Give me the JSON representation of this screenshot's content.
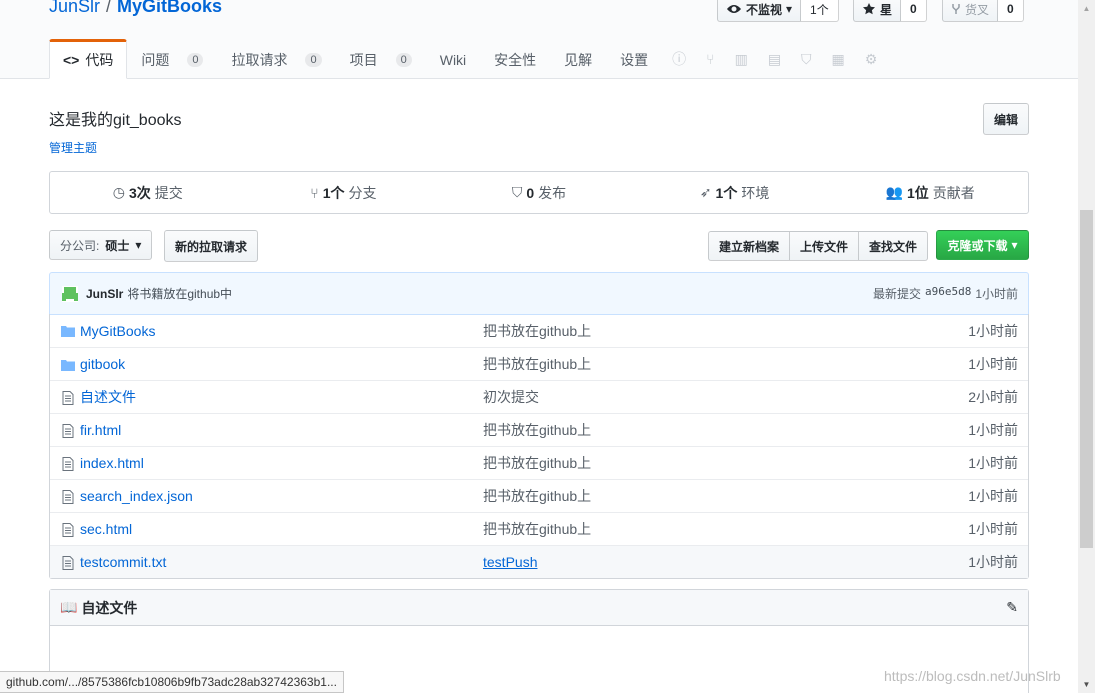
{
  "repo": {
    "owner": "JunSlr",
    "separator": "/",
    "name": "MyGitBooks"
  },
  "actions": {
    "watch_label": "不监视",
    "watch_count": "1个",
    "star_label": "星",
    "star_count": "0",
    "fork_label": "货叉",
    "fork_count": "0"
  },
  "nav": {
    "tabs": [
      {
        "label": "代码",
        "icon": "code-icon"
      },
      {
        "label": "问题",
        "count": "0"
      },
      {
        "label": "拉取请求",
        "count": "0"
      },
      {
        "label": "项目",
        "count": "0"
      },
      {
        "label": "Wiki"
      },
      {
        "label": "安全性"
      },
      {
        "label": "见解"
      },
      {
        "label": "设置"
      }
    ],
    "extra_icons": [
      "issue-opened-icon",
      "pull-request-icon",
      "project-icon",
      "book-icon",
      "shield-icon",
      "graph-icon",
      "gear-icon"
    ]
  },
  "about": {
    "description": "这是我的git_books",
    "topics_link": "管理主题",
    "edit_label": "编辑"
  },
  "summary": {
    "commits": {
      "num": "3次",
      "label": "提交",
      "icon": "history-icon"
    },
    "branches": {
      "num": "1个",
      "label": "分支",
      "icon": "branch-icon"
    },
    "releases": {
      "num": "0",
      "label": "发布",
      "icon": "tag-icon"
    },
    "environments": {
      "num": "1个",
      "label": "环境",
      "icon": "rocket-icon"
    },
    "contributors": {
      "num": "1位",
      "label": "贡献者",
      "icon": "people-icon"
    }
  },
  "file_nav": {
    "branch_label": "分公司:",
    "branch_value": "硕士",
    "new_pr": "新的拉取请求",
    "create_file": "建立新档案",
    "upload_files": "上传文件",
    "find_file": "查找文件",
    "clone": "克隆或下载"
  },
  "commit_tease": {
    "author": "JunSlr",
    "message": "将书籍放在github中",
    "latest_label": "最新提交",
    "sha": "a96e5d8",
    "age": "1小时前"
  },
  "files": [
    {
      "type": "folder",
      "name": "MyGitBooks",
      "message": "把书放在github上",
      "age": "1小时前"
    },
    {
      "type": "folder",
      "name": "gitbook",
      "message": "把书放在github上",
      "age": "1小时前"
    },
    {
      "type": "file",
      "name": "自述文件",
      "message": "初次提交",
      "age": "2小时前"
    },
    {
      "type": "file",
      "name": "fir.html",
      "message": "把书放在github上",
      "age": "1小时前"
    },
    {
      "type": "file",
      "name": "index.html",
      "message": "把书放在github上",
      "age": "1小时前"
    },
    {
      "type": "file",
      "name": "search_index.json",
      "message": "把书放在github上",
      "age": "1小时前"
    },
    {
      "type": "file",
      "name": "sec.html",
      "message": "把书放在github上",
      "age": "1小时前"
    },
    {
      "type": "file",
      "name": "testcommit.txt",
      "message": "testPush",
      "age": "1小时前"
    }
  ],
  "readme": {
    "title": "自述文件"
  },
  "status_url": "github.com/.../8575386fcb10806b9fb73adc28ab32742363b1...",
  "watermark": "https://blog.csdn.net/JunSlrb",
  "colors": {
    "accent": "#0366d6",
    "green": "#28a745",
    "selected_tab": "#e36209"
  }
}
